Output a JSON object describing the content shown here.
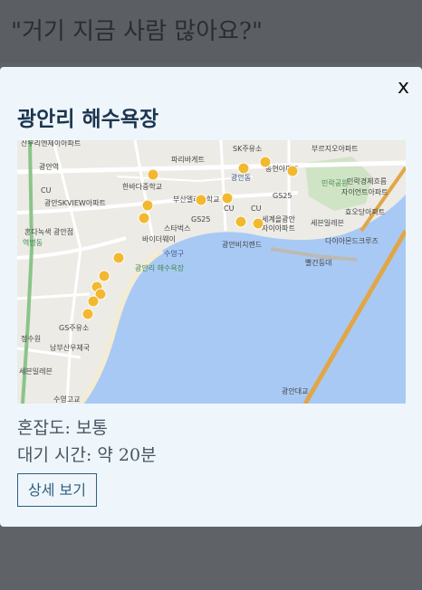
{
  "header": {
    "title": "\"거기 지금 사람 많아요?\""
  },
  "modal": {
    "close_label": "x",
    "title": "광안리 해수욕장",
    "congestion": "혼잡도: 보통",
    "wait_time": "대기 시간: 약 20분",
    "detail_button": "상세 보기"
  },
  "map": {
    "labels": {
      "l1": "산우리엔제이아파트",
      "l2": "파리바게트",
      "l3": "SK주유소",
      "l4": "부르지오아파트",
      "l5": "광안역",
      "l6": "CU",
      "l7": "한바다중학교",
      "l8": "송현아파트",
      "l9": "민락공원",
      "l10": "광안SKVIEW아파트",
      "l11": "부산엘리트학교",
      "l12": "GS25",
      "l13": "민락경제흐름",
      "l14": "자이언트아파트",
      "l15": "CU",
      "l16": "효오당아파트",
      "l17": "혼다녹색 광안점",
      "l18": "스타벅스",
      "l19": "GS25",
      "l20": "세계을광안",
      "l21": "자이아파트",
      "l22": "세븐일레븐",
      "l23": "바이더웨이",
      "l24": "광안비치랜드",
      "l25": "다이아몬드크루즈",
      "l26": "수영구",
      "l27": "광안리 해수욕장",
      "l28": "빨간등대",
      "l29": "GS주유소",
      "l30": "남부산우체국",
      "l31": "세븐일레븐",
      "l32": "광안대교",
      "l33": "수영고교",
      "l34": "역명동",
      "l35": "광안동",
      "l36": "정수원",
      "l37": "CU"
    }
  }
}
